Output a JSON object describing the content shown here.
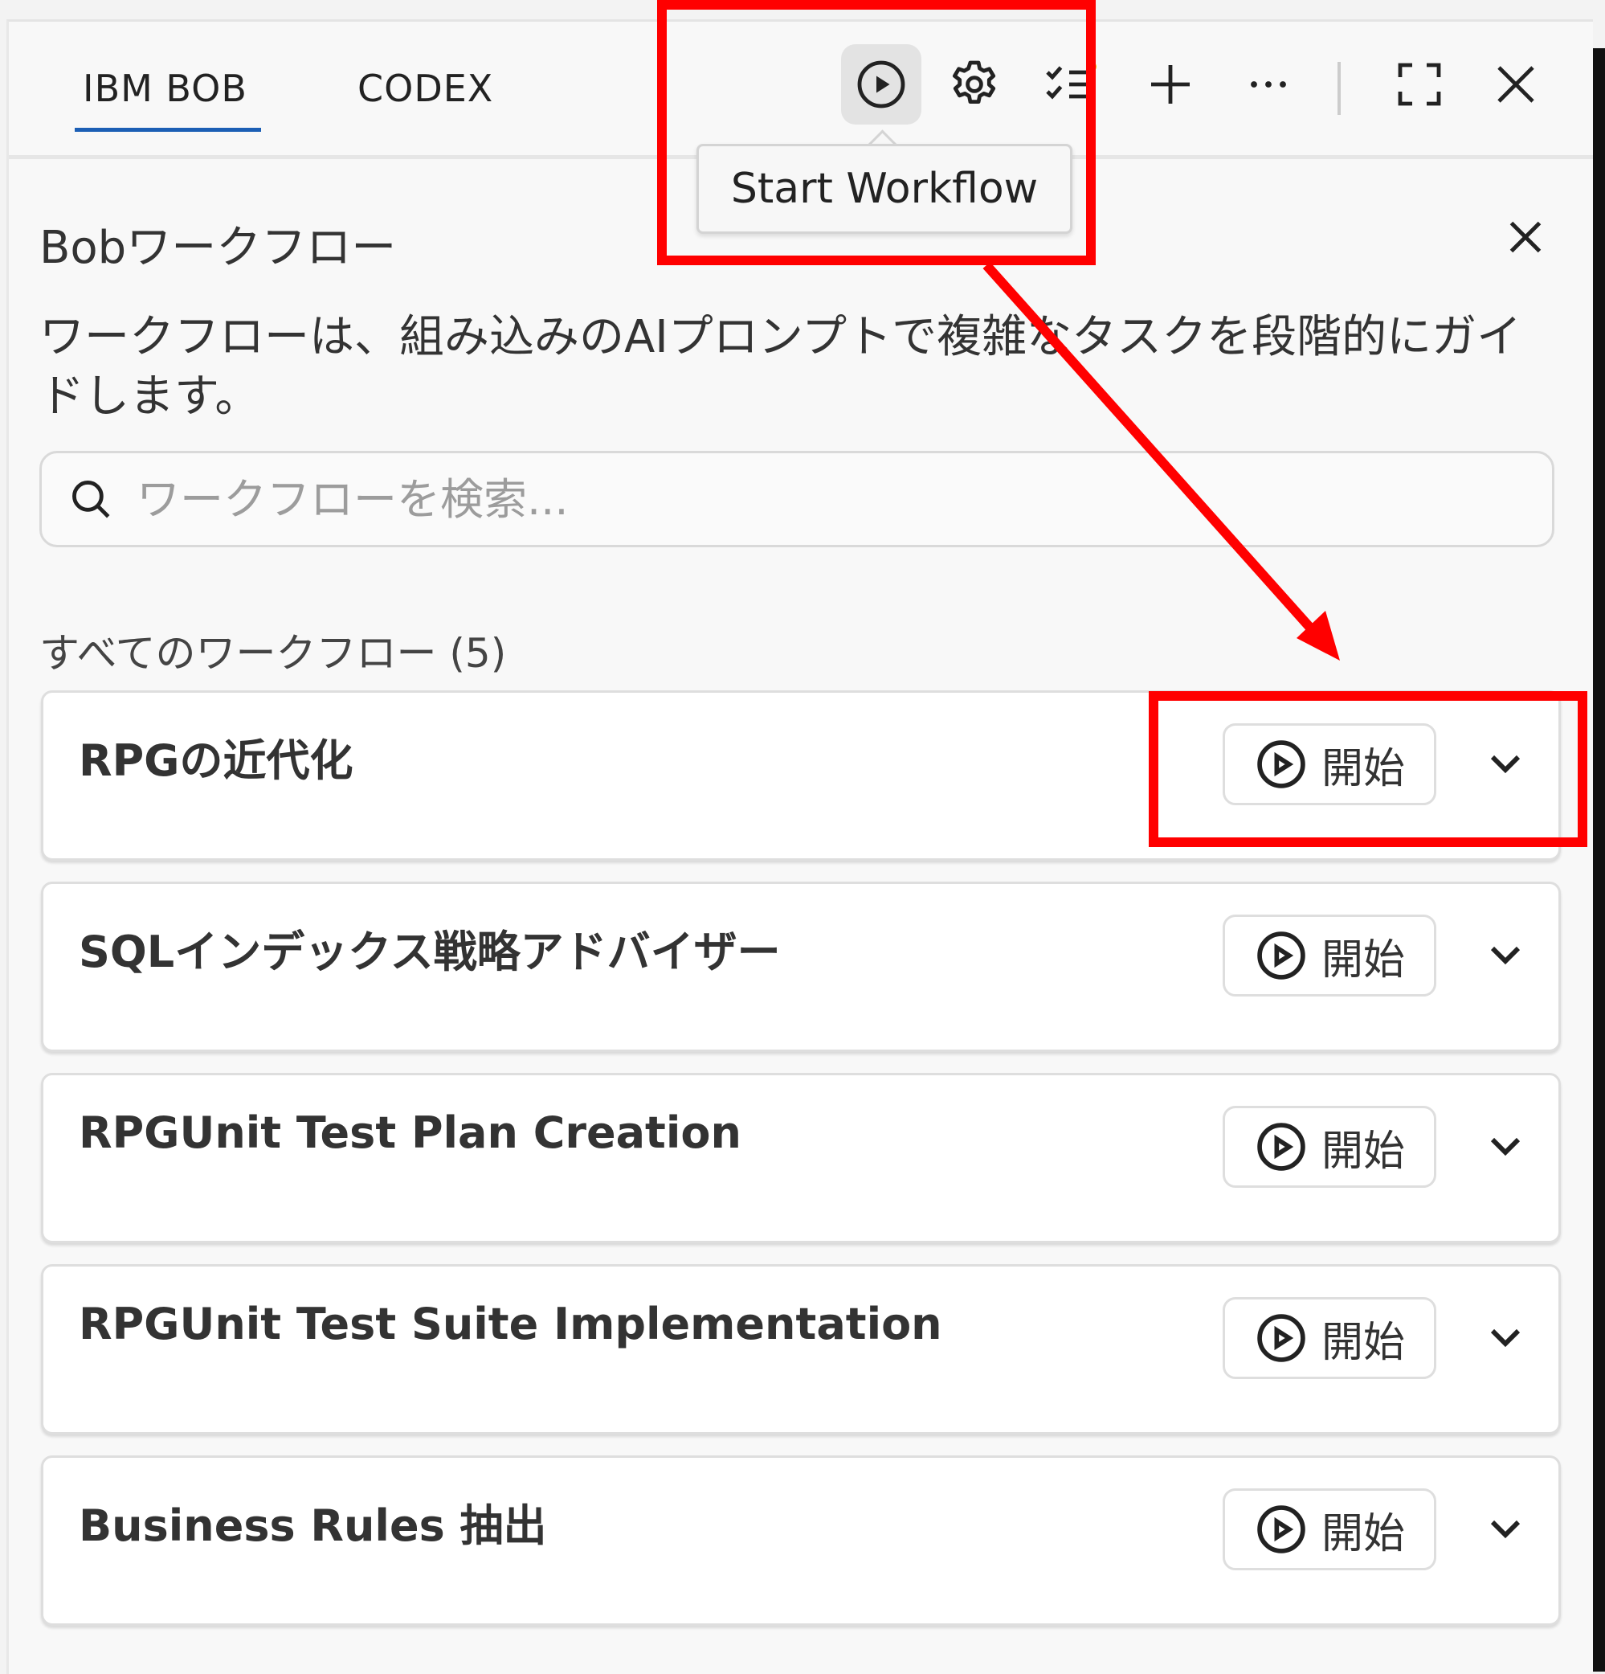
{
  "tabs": [
    {
      "label": "IBM BOB",
      "active": true
    },
    {
      "label": "CODEX",
      "active": false
    }
  ],
  "toolbar": {
    "icons": [
      "play-circle-icon",
      "gear-icon",
      "checklist-icon",
      "plus-icon",
      "more-icon",
      "expand-icon",
      "close-icon"
    ],
    "tooltip": "Start Workflow"
  },
  "panel": {
    "title": "Bobワークフロー",
    "description": "ワークフローは、組み込みのAIプロンプトで複雑なタスクを段階的にガイドします。",
    "search_placeholder": "ワークフローを検索...",
    "section_label": "すべてのワークフロー (5)"
  },
  "workflows": [
    {
      "name": "RPGの近代化",
      "start_label": "開始"
    },
    {
      "name": "SQLインデックス戦略アドバイザー",
      "start_label": "開始"
    },
    {
      "name": "RPGUnit Test Plan Creation",
      "start_label": "開始"
    },
    {
      "name": "RPGUnit Test Suite Implementation",
      "start_label": "開始"
    },
    {
      "name": "Business Rules 抽出",
      "start_label": "開始"
    }
  ],
  "colors": {
    "accent": "#1c5fb5",
    "highlight": "#ff0000",
    "background": "#f8f8f8"
  }
}
